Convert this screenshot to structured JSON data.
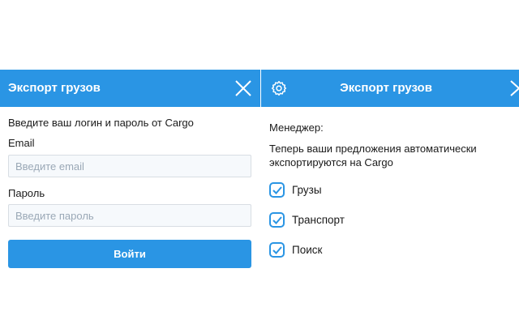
{
  "login_panel": {
    "title": "Экспорт грузов",
    "intro": "Введите ваш логин и пароль от Cargo",
    "email_label": "Email",
    "email_placeholder": "Введите email",
    "email_value": "",
    "password_label": "Пароль",
    "password_placeholder": "Введите пароль",
    "password_value": "",
    "login_button": "Войти"
  },
  "settings_panel": {
    "title": "Экспорт грузов",
    "manager_label": "Менеджер:",
    "message_line1": "Теперь ваши предложения автоматически",
    "message_line2": "экспортируются на Cargo",
    "options": [
      {
        "label": "Грузы",
        "checked": true
      },
      {
        "label": "Транспорт",
        "checked": true
      },
      {
        "label": "Поиск",
        "checked": true
      }
    ]
  },
  "colors": {
    "accent": "#2a95e4"
  }
}
